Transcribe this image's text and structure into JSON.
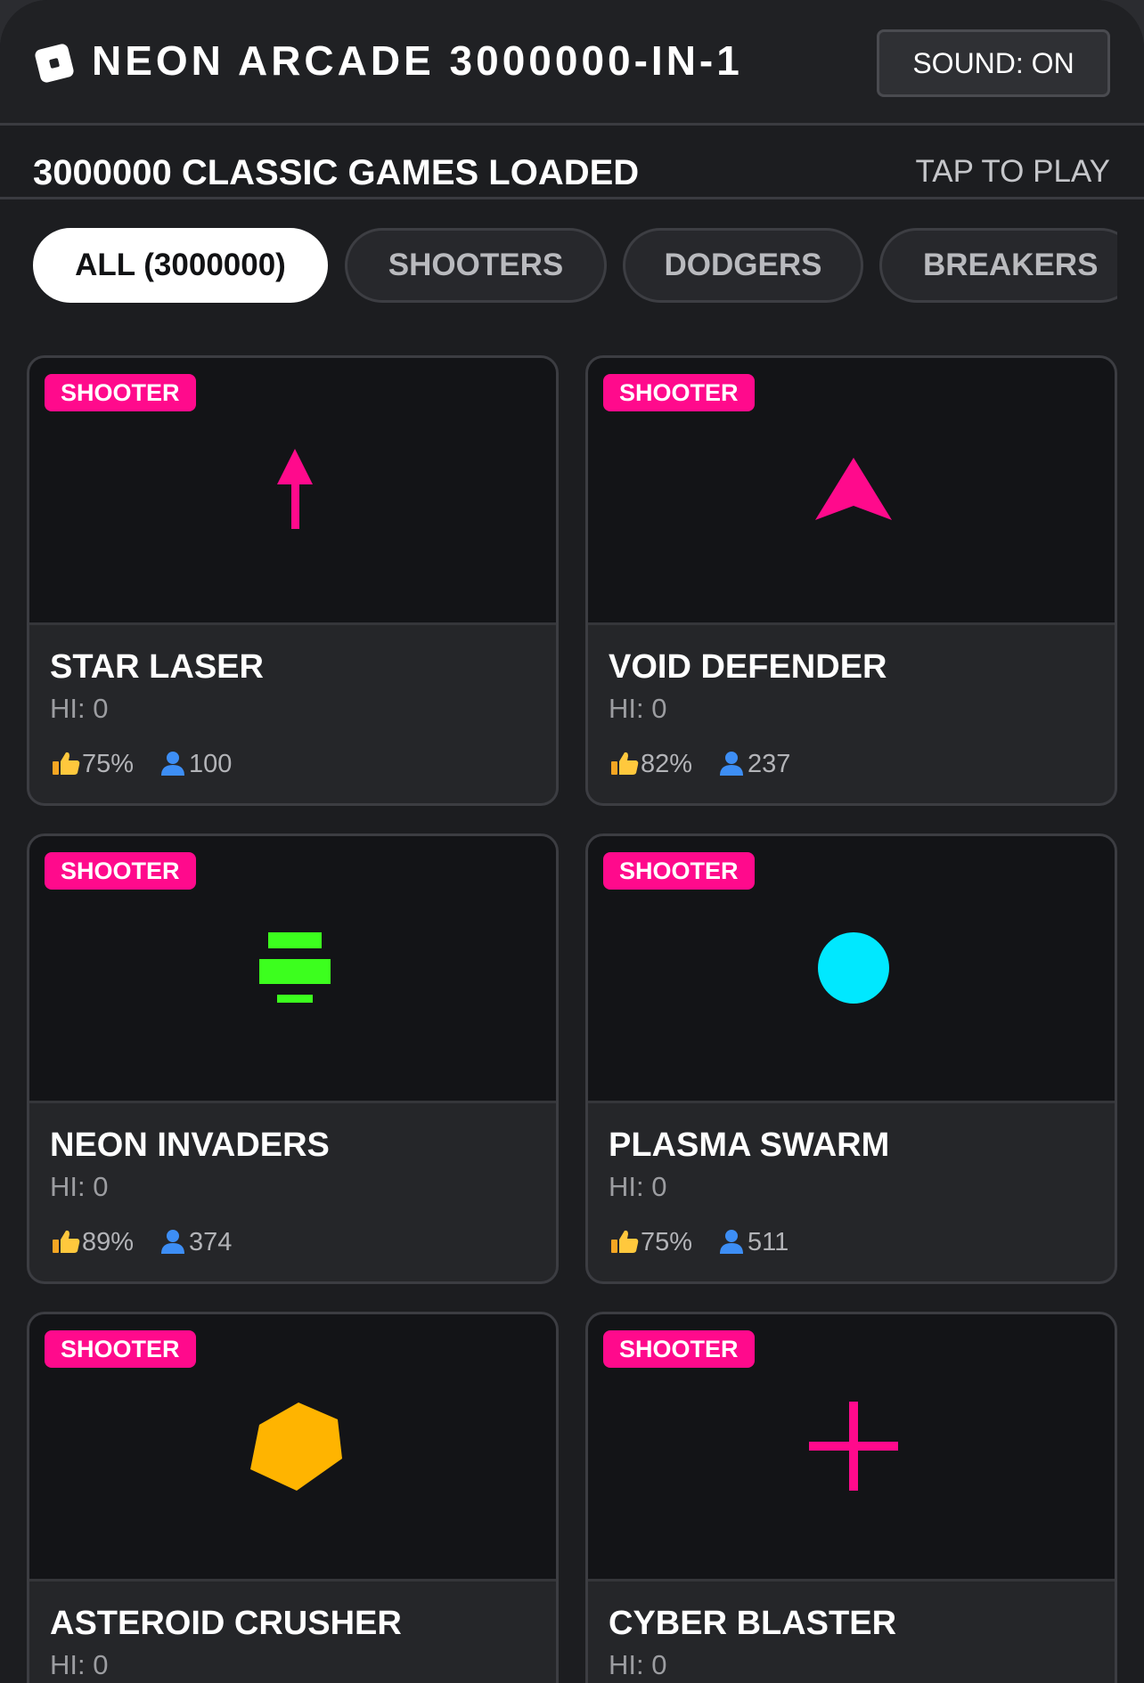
{
  "header": {
    "title": "NEON ARCADE 3000000-IN-1",
    "sound_label": "SOUND: ON"
  },
  "subbar": {
    "loaded_text": "3000000 CLASSIC GAMES LOADED",
    "hint": "TAP TO PLAY"
  },
  "filters": [
    "ALL (3000000)",
    "SHOOTERS",
    "DODGERS",
    "BREAKERS"
  ],
  "active_filter": "ALL (3000000)",
  "colors": {
    "accent_pink": "#ff0a8c",
    "neon_green": "#3cff1e",
    "neon_cyan": "#00e8ff",
    "neon_amber": "#ffb400"
  },
  "games": [
    {
      "badge": "SHOOTER",
      "title": "STAR LASER",
      "hi": "HI: 0",
      "rating": "75%",
      "players": "100",
      "icon": "arrow-up-icon",
      "icon_color": "#ff0a8c"
    },
    {
      "badge": "SHOOTER",
      "title": "VOID DEFENDER",
      "hi": "HI: 0",
      "rating": "82%",
      "players": "237",
      "icon": "ship-icon",
      "icon_color": "#ff0a8c"
    },
    {
      "badge": "SHOOTER",
      "title": "NEON INVADERS",
      "hi": "HI: 0",
      "rating": "89%",
      "players": "374",
      "icon": "invader-icon",
      "icon_color": "#3cff1e"
    },
    {
      "badge": "SHOOTER",
      "title": "PLASMA SWARM",
      "hi": "HI: 0",
      "rating": "75%",
      "players": "511",
      "icon": "orb-icon",
      "icon_color": "#00e8ff"
    },
    {
      "badge": "SHOOTER",
      "title": "ASTEROID CRUSHER",
      "hi": "HI: 0",
      "rating": "",
      "players": "",
      "icon": "asteroid-icon",
      "icon_color": "#ffb400"
    },
    {
      "badge": "SHOOTER",
      "title": "CYBER BLASTER",
      "hi": "HI: 0",
      "rating": "",
      "players": "",
      "icon": "crosshair-icon",
      "icon_color": "#ff0a8c"
    }
  ]
}
